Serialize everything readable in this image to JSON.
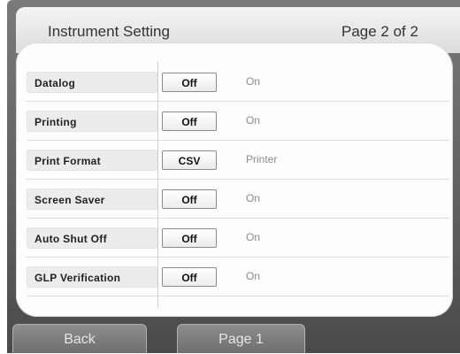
{
  "header": {
    "title": "Instrument Setting",
    "page": "Page 2 of 2"
  },
  "settings": [
    {
      "label": "Datalog",
      "value": "Off",
      "alternate": "On"
    },
    {
      "label": "Printing",
      "value": "Off",
      "alternate": "On"
    },
    {
      "label": "Print Format",
      "value": "CSV",
      "alternate": "Printer"
    },
    {
      "label": "Screen Saver",
      "value": "Off",
      "alternate": "On"
    },
    {
      "label": "Auto Shut Off",
      "value": "Off",
      "alternate": "On"
    },
    {
      "label": "GLP Verification",
      "value": "Off",
      "alternate": "On"
    }
  ],
  "footer": {
    "back_label": "Back",
    "page1_label": "Page 1"
  }
}
